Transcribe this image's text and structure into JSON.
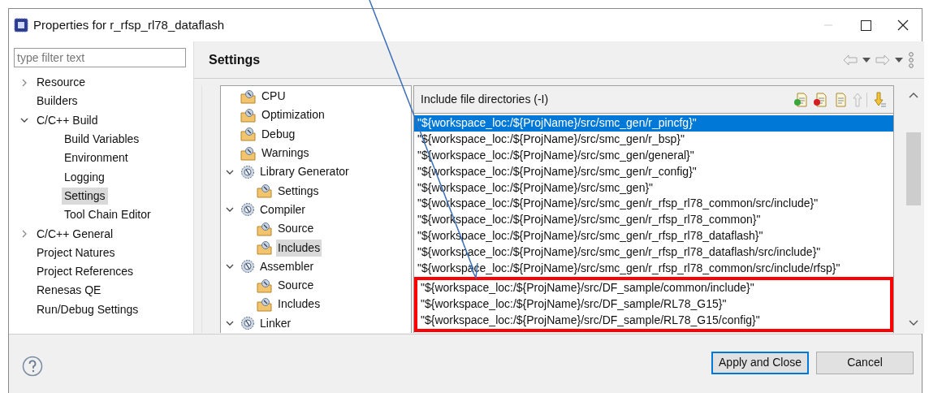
{
  "window": {
    "title": "Properties for r_rfsp_rl78_dataflash"
  },
  "filter": {
    "placeholder": "type filter text"
  },
  "sidebar": {
    "items": [
      {
        "label": "Resource",
        "expanded": false,
        "selected": false
      },
      {
        "label": "Builders",
        "selected": false
      },
      {
        "label": "C/C++ Build",
        "expanded": true,
        "selected": false,
        "children": [
          {
            "label": "Build Variables",
            "selected": false
          },
          {
            "label": "Environment",
            "selected": false
          },
          {
            "label": "Logging",
            "selected": false
          },
          {
            "label": "Settings",
            "selected": true
          },
          {
            "label": "Tool Chain Editor",
            "selected": false
          }
        ]
      },
      {
        "label": "C/C++ General",
        "expanded": false,
        "selected": false
      },
      {
        "label": "Project Natures",
        "selected": false
      },
      {
        "label": "Project References",
        "selected": false
      },
      {
        "label": "Renesas QE",
        "selected": false
      },
      {
        "label": "Run/Debug Settings",
        "selected": false
      }
    ]
  },
  "page_title": "Settings",
  "tool_tree": {
    "items": [
      {
        "label": "CPU",
        "selected": false
      },
      {
        "label": "Optimization",
        "selected": false
      },
      {
        "label": "Debug",
        "selected": false
      },
      {
        "label": "Warnings",
        "selected": false
      },
      {
        "label": "Library Generator",
        "expanded": true,
        "selected": false,
        "children": [
          {
            "label": "Settings",
            "selected": false
          }
        ]
      },
      {
        "label": "Compiler",
        "expanded": true,
        "selected": false,
        "children": [
          {
            "label": "Source",
            "selected": false
          },
          {
            "label": "Includes",
            "selected": true
          }
        ]
      },
      {
        "label": "Assembler",
        "expanded": true,
        "selected": false,
        "children": [
          {
            "label": "Source",
            "selected": false
          },
          {
            "label": "Includes",
            "selected": false
          }
        ]
      },
      {
        "label": "Linker",
        "expanded": true,
        "selected": false
      }
    ]
  },
  "include_list": {
    "title": "Include file directories (-I)",
    "rows": [
      {
        "path": "\"${workspace_loc:/${ProjName}/src/smc_gen/r_pincfg}\"",
        "selected": true,
        "highlighted": false
      },
      {
        "path": "\"${workspace_loc:/${ProjName}/src/smc_gen/r_bsp}\"",
        "selected": false,
        "highlighted": false
      },
      {
        "path": "\"${workspace_loc:/${ProjName}/src/smc_gen/general}\"",
        "selected": false,
        "highlighted": false
      },
      {
        "path": "\"${workspace_loc:/${ProjName}/src/smc_gen/r_config}\"",
        "selected": false,
        "highlighted": false
      },
      {
        "path": "\"${workspace_loc:/${ProjName}/src/smc_gen}\"",
        "selected": false,
        "highlighted": false
      },
      {
        "path": "\"${workspace_loc:/${ProjName}/src/smc_gen/r_rfsp_rl78_common/src/include}\"",
        "selected": false,
        "highlighted": false
      },
      {
        "path": "\"${workspace_loc:/${ProjName}/src/smc_gen/r_rfsp_rl78_common}\"",
        "selected": false,
        "highlighted": false
      },
      {
        "path": "\"${workspace_loc:/${ProjName}/src/smc_gen/r_rfsp_rl78_dataflash}\"",
        "selected": false,
        "highlighted": false
      },
      {
        "path": "\"${workspace_loc:/${ProjName}/src/smc_gen/r_rfsp_rl78_dataflash/src/include}\"",
        "selected": false,
        "highlighted": false
      },
      {
        "path": "\"${workspace_loc:/${ProjName}/src/smc_gen/r_rfsp_rl78_common/src/include/rfsp}\"",
        "selected": false,
        "highlighted": false
      },
      {
        "path": "\"${workspace_loc:/${ProjName}/src/DF_sample/common/include}\"",
        "selected": false,
        "highlighted": true
      },
      {
        "path": "\"${workspace_loc:/${ProjName}/src/DF_sample/RL78_G15}\"",
        "selected": false,
        "highlighted": true
      },
      {
        "path": "\"${workspace_loc:/${ProjName}/src/DF_sample/RL78_G15/config}\"",
        "selected": false,
        "highlighted": true
      }
    ]
  },
  "buttons": [
    {
      "label": "Apply and Close",
      "default": true
    },
    {
      "label": "Cancel",
      "default": false
    }
  ]
}
